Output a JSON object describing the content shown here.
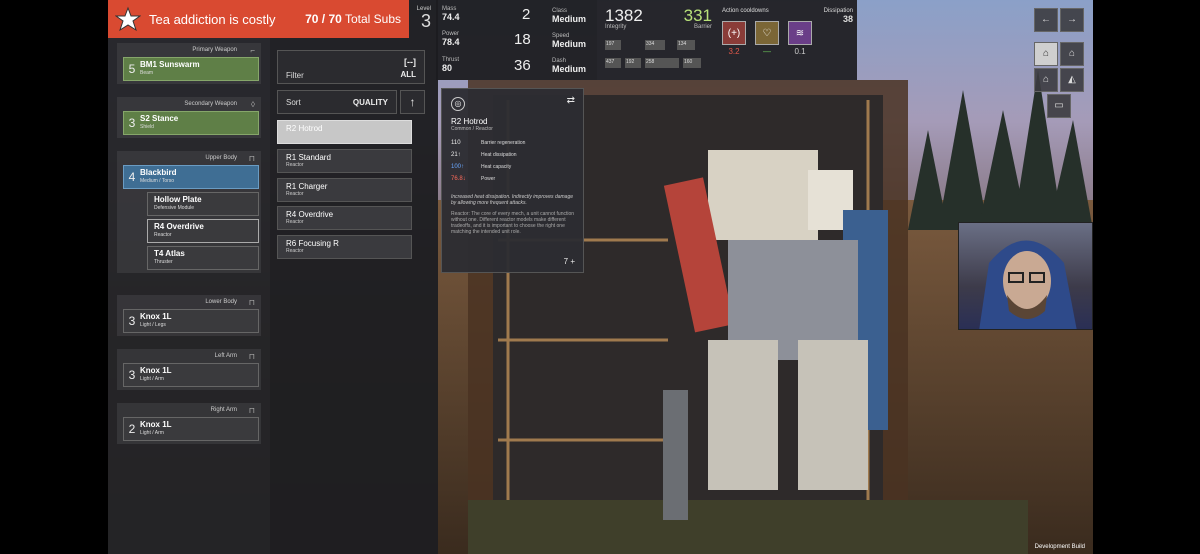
{
  "notification": {
    "message": "Tea addiction is costly",
    "subs_count": "70 / 70",
    "subs_label": "Total Subs"
  },
  "level": {
    "label": "Level",
    "value": "3"
  },
  "stats": {
    "mass_label": "Mass",
    "mass_value": "74.4",
    "mass_num": "2",
    "power_label": "Power",
    "power_value": "78.4",
    "power_num": "18",
    "thrust_label": "Thrust",
    "thrust_value": "80",
    "thrust_num": "36",
    "class_label": "Class",
    "class_value": "Medium",
    "speed_label": "Speed",
    "speed_value": "Medium",
    "dash_label": "Dash",
    "dash_value": "Medium"
  },
  "integrity": {
    "value": "1382",
    "label": "Integrity",
    "barrier_value": "331",
    "barrier_label": "Barrier",
    "cells": [
      "197",
      "334",
      "134",
      "437",
      "192",
      "258",
      "160"
    ]
  },
  "cooldowns": {
    "title": "Action cooldowns",
    "dissipation_label": "Dissipation",
    "dissipation_value": "38",
    "values": [
      "3.2",
      "—",
      "0.1"
    ],
    "colors": [
      "#e2584a",
      "#6fcf5a",
      "#cccccc"
    ]
  },
  "slots": [
    {
      "header": "Primary Weapon",
      "num": "5",
      "name": "BM1 Sunswarm",
      "type": "Beam"
    },
    {
      "header": "Secondary Weapon",
      "num": "3",
      "name": "S2 Stance",
      "type": "Shield"
    },
    {
      "header": "Upper Body",
      "num": "4",
      "name": "Blackbird",
      "type": "Medium / Torso",
      "subs": [
        {
          "name": "Hollow Plate",
          "type": "Defensive Module"
        },
        {
          "name": "R4 Overdrive",
          "type": "Reactor"
        },
        {
          "name": "T4 Atlas",
          "type": "Thruster"
        }
      ]
    },
    {
      "header": "Lower Body",
      "num": "3",
      "name": "Knox 1L",
      "type": "Light / Legs"
    },
    {
      "header": "Left Arm",
      "num": "3",
      "name": "Knox 1L",
      "type": "Light / Arm"
    },
    {
      "header": "Right Arm",
      "num": "2",
      "name": "Knox 1L",
      "type": "Light / Arm"
    }
  ],
  "filter": {
    "label": "Filter",
    "value": "ALL",
    "icon": "[--]"
  },
  "sort": {
    "label": "Sort",
    "value": "QUALITY",
    "direction": "↑"
  },
  "items": [
    {
      "name": "R2 Hotrod",
      "type": ""
    },
    {
      "name": "R1 Standard",
      "type": "Reactor"
    },
    {
      "name": "R1 Charger",
      "type": "Reactor"
    },
    {
      "name": "R4 Overdrive",
      "type": "Reactor"
    },
    {
      "name": "R6 Focusing R",
      "type": "Reactor"
    }
  ],
  "tooltip": {
    "title": "R2 Hotrod",
    "subtitle": "Common / Reactor",
    "rows": [
      {
        "value": "110",
        "name": "Barrier regeneration"
      },
      {
        "value": "21↑",
        "name": "Heat dissipation"
      },
      {
        "value": "100↑",
        "name": "Heat capacity"
      },
      {
        "value": "76.8↓",
        "name": "Power"
      }
    ],
    "description": "Increased heat dissipation. Indirectly improves damage by allowing more frequent attacks.",
    "lore": "Reactor: The core of every mech, a unit cannot function without one. Different reactor models make different tradeoffs, and it is important to choose the right one matching the intended unit role.",
    "count": "7 +"
  },
  "footer": {
    "build": "Development Build"
  }
}
